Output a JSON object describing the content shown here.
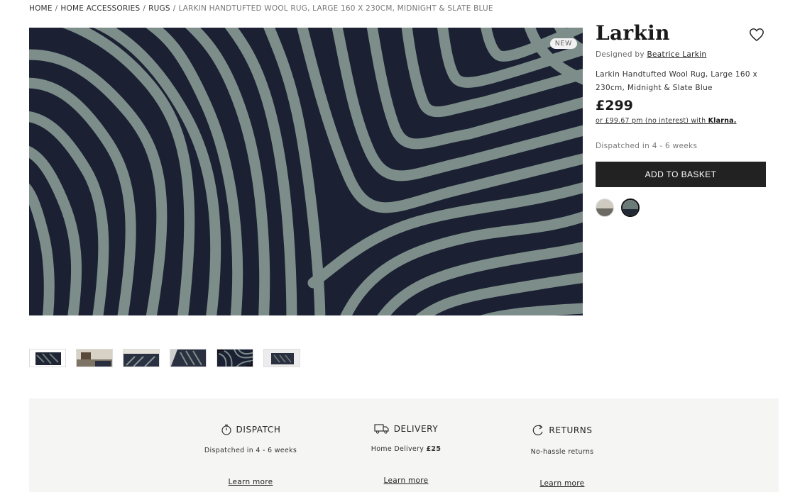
{
  "breadcrumb": {
    "items": [
      "HOME",
      "HOME ACCESSORIES",
      "RUGS"
    ],
    "current": "LARKIN HANDTUFTED WOOL RUG, LARGE 160 X 230CM, MIDNIGHT & SLATE BLUE",
    "separator": "/"
  },
  "gallery": {
    "badge": "NEW",
    "thumbnail_count": 6,
    "active_thumbnail": 5
  },
  "product": {
    "title": "Larkin",
    "designed_by_label": "Designed by",
    "designer": "Beatrice Larkin",
    "description": "Larkin Handtufted Wool Rug, Large 160 x 230cm, Midnight & Slate Blue",
    "price": "£299",
    "klarna_text": "or £99.67 pm (no interest) with",
    "klarna_brand": "Klarna.",
    "dispatch": "Dispatched in 4 - 6 weeks",
    "add_to_basket": "ADD TO BASKET",
    "swatches": [
      {
        "name": "natural",
        "top": "#cfcac0",
        "bottom": "#6d6a63"
      },
      {
        "name": "midnight-slate",
        "top": "#6b7c78",
        "bottom": "#222a36"
      }
    ],
    "selected_swatch": 1
  },
  "info": [
    {
      "icon": "stopwatch-icon",
      "title": "DISPATCH",
      "text": "Dispatched in 4 - 6 weeks",
      "text_bold": "",
      "link": "Learn more"
    },
    {
      "icon": "truck-icon",
      "title": "DELIVERY",
      "text": "Home Delivery",
      "text_bold": "£25",
      "link": "Learn more"
    },
    {
      "icon": "returns-icon",
      "title": "RETURNS",
      "text": "No-hassle returns",
      "text_bold": "",
      "link": "Learn more"
    }
  ],
  "colors": {
    "rug_dark": "#1b2133",
    "rug_light": "#7d8e8a",
    "button": "#222222",
    "band": "#f5f5f4"
  }
}
